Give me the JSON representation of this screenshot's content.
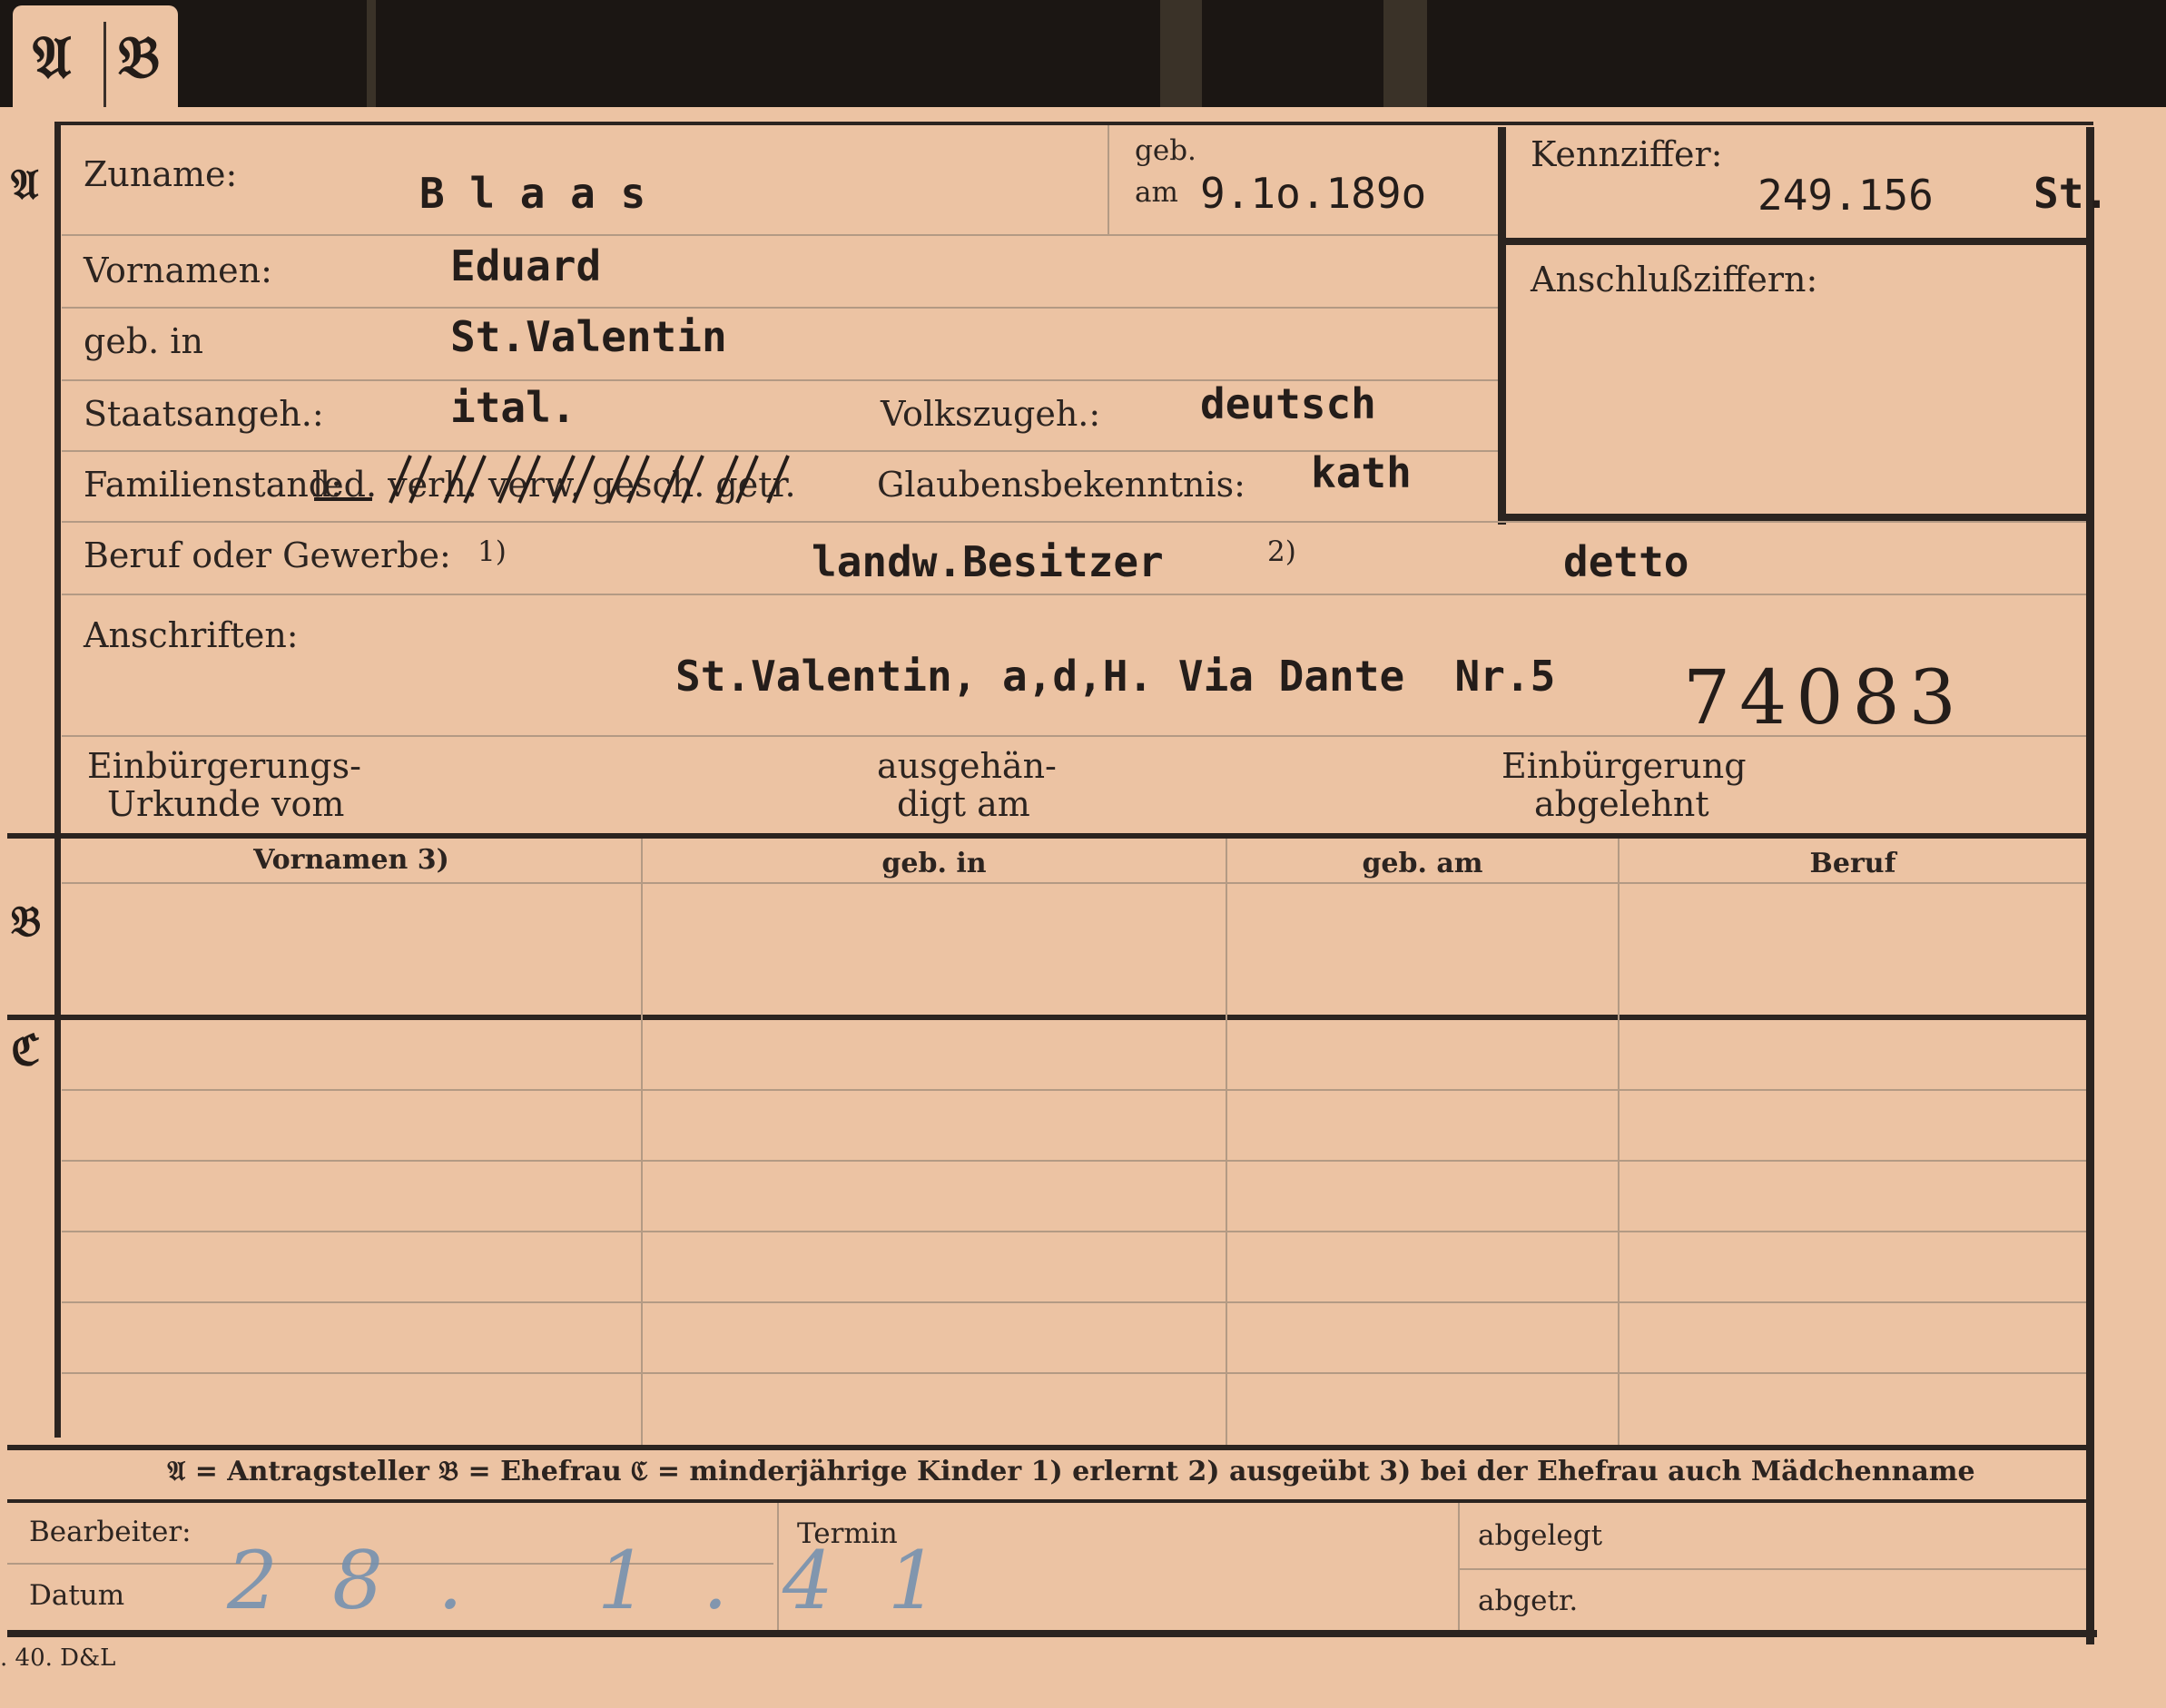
{
  "tab": {
    "letter_a": "𝔄",
    "letter_b": "𝔅"
  },
  "sections": {
    "a": "𝔄",
    "b": "𝔅",
    "c": "ℭ"
  },
  "person": {
    "surname_label": "Zuname:",
    "surname": "B l a a s",
    "born_label_1": "geb.",
    "born_label_2": "am",
    "born_date": "9.1o.189o",
    "firstnames_label": "Vornamen:",
    "firstnames": "Eduard",
    "birthplace_label": "geb. in",
    "birthplace": "St.Valentin",
    "citizenship_label": "Staatsangeh.:",
    "citizenship": "ital.",
    "ethnicity_label": "Volkszugeh.:",
    "ethnicity": "deutsch",
    "family_status_label": "Familienstand:",
    "family_status_options": "led. verh. verw. gesch. getr.",
    "religion_label": "Glaubensbekenntnis:",
    "religion": "kath",
    "occupation_label": "Beruf oder Gewerbe:",
    "fn1": "1)",
    "occupation_learned": "landw.Besitzer",
    "fn2": "2)",
    "occupation_practiced": "detto",
    "address_label": "Anschriften:",
    "address": "St.Valentin, a,d,H. Via Dante  Nr.5",
    "stamp_number": "74083",
    "naturalization_doc_label_1": "Einbürgerungs-",
    "naturalization_doc_label_2": "Urkunde vom",
    "handed_out_label_1": "ausgehän-",
    "handed_out_label_2": "digt am",
    "naturalization_refused_label_1": "Einbürgerung",
    "naturalization_refused_label_2": "abgelehnt"
  },
  "ident": {
    "code_label": "Kennziffer:",
    "code": "249.156",
    "code_suffix": "St.",
    "connection_label": "Anschlußziffern:"
  },
  "spouse_table": {
    "headers": [
      "Vornamen 3)",
      "geb. in",
      "geb. am",
      "Beruf"
    ]
  },
  "legend": "𝔄 = Antragsteller   𝔅 = Ehefrau   ℭ = minderjährige Kinder   1) erlernt   2) ausgeübt   3) bei der Ehefrau auch Mädchenname",
  "footer": {
    "clerk_label": "Bearbeiter:",
    "date_label": "Datum",
    "deadline_label": "Termin",
    "filed_label": "abgelegt",
    "sent_label": "abgetr.",
    "handwritten_date": "28. 1.41",
    "print_mark": ". 40. D&L"
  }
}
